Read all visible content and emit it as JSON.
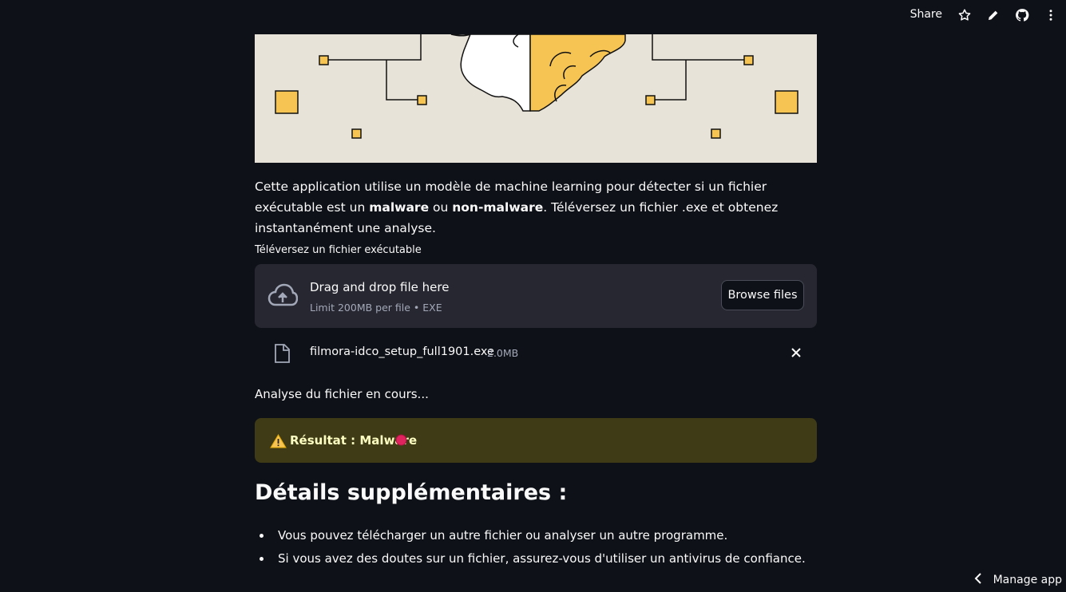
{
  "toolbar": {
    "share_label": "Share",
    "icons": [
      "star-icon",
      "pencil-icon",
      "github-icon",
      "more-vertical-icon"
    ]
  },
  "intro": {
    "part1": "Cette application utilise un modèle de machine learning pour détecter si un fichier exécutable est un ",
    "bold1": "malware",
    "part2": " ou ",
    "bold2": "non-malware",
    "part3": ". Téléversez un fichier .exe et obtenez instantanément une analyse."
  },
  "uploader": {
    "label": "Téléversez un fichier exécutable",
    "drag_text": "Drag and drop file here",
    "limit_text": "Limit 200MB per file • EXE",
    "browse_label": "Browse files"
  },
  "file": {
    "name": "filmora-idco_setup_full1901.exe",
    "size": "2.0MB"
  },
  "analysis_text": "Analyse du fichier en cours...",
  "result": {
    "text": "Résultat : Malware",
    "accent": "#3e3b16",
    "dot_color": "#e0245e"
  },
  "details": {
    "title": "Détails supplémentaires :",
    "items": [
      "Vous pouvez télécharger un autre fichier ou analyser un autre programme.",
      "Si vous avez des doutes sur un fichier, assurez-vous d'utiliser un antivirus de confiance."
    ]
  },
  "footer": {
    "manage_label": "Manage app"
  },
  "colors": {
    "background": "#0e1117",
    "hero_bg": "#e8e3d8",
    "hero_accent": "#f6c453"
  }
}
